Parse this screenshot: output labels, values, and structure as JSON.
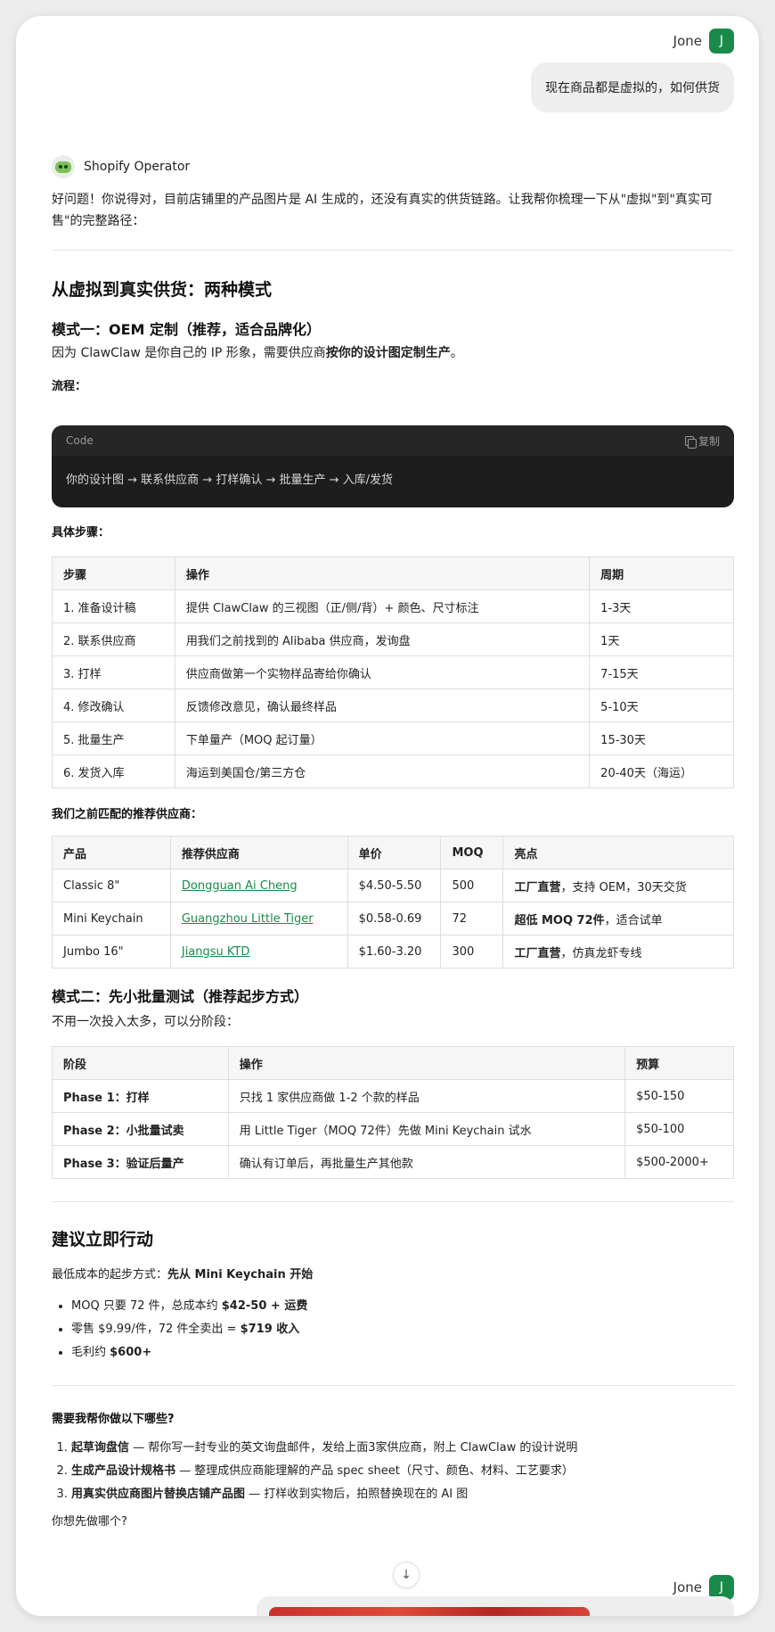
{
  "user": {
    "name": "Jone",
    "avatar_letter": "J",
    "message": "现在商品都是虚拟的，如何供货"
  },
  "assistant": {
    "name": "Shopify Operator",
    "intro": "好问题！你说得对，目前店铺里的产品图片是 AI 生成的，还没有真实的供货链路。让我帮你梳理一下从\"虚拟\"到\"真实可售\"的完整路径："
  },
  "section1": {
    "title": "从虚拟到真实供货：两种模式",
    "mode1_title": "模式一：OEM 定制（推荐，适合品牌化）",
    "mode1_desc_prefix": "因为 ClawClaw 是你自己的 IP 形象，需要供应商",
    "mode1_desc_bold": "按你的设计图定制生产",
    "mode1_desc_suffix": "。",
    "flow_label": "流程：",
    "code": {
      "label": "Code",
      "copy_label": "复制",
      "content": "你的设计图 → 联系供应商 → 打样确认 → 批量生产 → 入库/发货"
    },
    "steps_label": "具体步骤：",
    "steps_table": {
      "headers": [
        "步骤",
        "操作",
        "周期"
      ],
      "rows": [
        [
          "1. 准备设计稿",
          "提供 ClawClaw 的三视图（正/侧/背）+ 颜色、尺寸标注",
          "1-3天"
        ],
        [
          "2. 联系供应商",
          "用我们之前找到的 Alibaba 供应商，发询盘",
          "1天"
        ],
        [
          "3. 打样",
          "供应商做第一个实物样品寄给你确认",
          "7-15天"
        ],
        [
          "4. 修改确认",
          "反馈修改意见，确认最终样品",
          "5-10天"
        ],
        [
          "5. 批量生产",
          "下单量产（MOQ 起订量）",
          "15-30天"
        ],
        [
          "6. 发货入库",
          "海运到美国仓/第三方仓",
          "20-40天（海运）"
        ]
      ]
    },
    "suppliers_label": "我们之前匹配的推荐供应商：",
    "suppliers_table": {
      "headers": [
        "产品",
        "推荐供应商",
        "单价",
        "MOQ",
        "亮点"
      ],
      "rows": [
        {
          "product": "Classic 8\"",
          "supplier": "Dongguan Ai Cheng",
          "price": "$4.50-5.50",
          "moq": "500",
          "hl_bold": "工厂直营",
          "hl_rest": "，支持 OEM，30天交货"
        },
        {
          "product": "Mini Keychain",
          "supplier": "Guangzhou Little Tiger",
          "price": "$0.58-0.69",
          "moq": "72",
          "hl_bold": "超低 MOQ 72件",
          "hl_rest": "，适合试单"
        },
        {
          "product": "Jumbo 16\"",
          "supplier": "Jiangsu KTD",
          "price": "$1.60-3.20",
          "moq": "300",
          "hl_bold": "工厂直营",
          "hl_rest": "，仿真龙虾专线"
        }
      ]
    },
    "mode2_title": "模式二：先小批量测试（推荐起步方式）",
    "mode2_desc": "不用一次投入太多，可以分阶段：",
    "phase_table": {
      "headers": [
        "阶段",
        "操作",
        "预算"
      ],
      "rows": [
        [
          "Phase 1：打样",
          "只找 1 家供应商做 1-2 个款的样品",
          "$50-150"
        ],
        [
          "Phase 2：小批量试卖",
          "用 Little Tiger（MOQ 72件）先做 Mini Keychain 试水",
          "$50-100"
        ],
        [
          "Phase 3：验证后量产",
          "确认有订单后，再批量生产其他款",
          "$500-2000+"
        ]
      ]
    }
  },
  "section2": {
    "title": "建议立即行动",
    "lead_prefix": "最低成本的起步方式：",
    "lead_bold": "先从 Mini Keychain 开始",
    "bullets": [
      {
        "prefix": "MOQ 只要 72 件，总成本约 ",
        "bold": "$42-50 + 运费",
        "suffix": ""
      },
      {
        "prefix": "零售 $9.99/件，72 件全卖出 = ",
        "bold": "$719 收入",
        "suffix": ""
      },
      {
        "prefix": "毛利约 ",
        "bold": "$600+",
        "suffix": ""
      }
    ]
  },
  "section3": {
    "question": "需要我帮你做以下哪些?",
    "items": [
      {
        "bold": "起草询盘信",
        "rest": " — 帮你写一封专业的英文询盘邮件，发给上面3家供应商，附上 ClawClaw 的设计说明"
      },
      {
        "bold": "生成产品设计规格书",
        "rest": " — 整理成供应商能理解的产品 spec sheet（尺寸、颜色、材料、工艺要求）"
      },
      {
        "bold": "用真实供应商图片替换店铺产品图",
        "rest": " — 打样收到实物后，拍照替换现在的 AI 图"
      }
    ],
    "closing": "你想先做哪个?"
  },
  "scroll_icon": "arrow-down-icon",
  "colors": {
    "accent": "#1a8a4a",
    "code_bg": "#1d1d1d",
    "bubble_bg": "#eeeeee"
  }
}
